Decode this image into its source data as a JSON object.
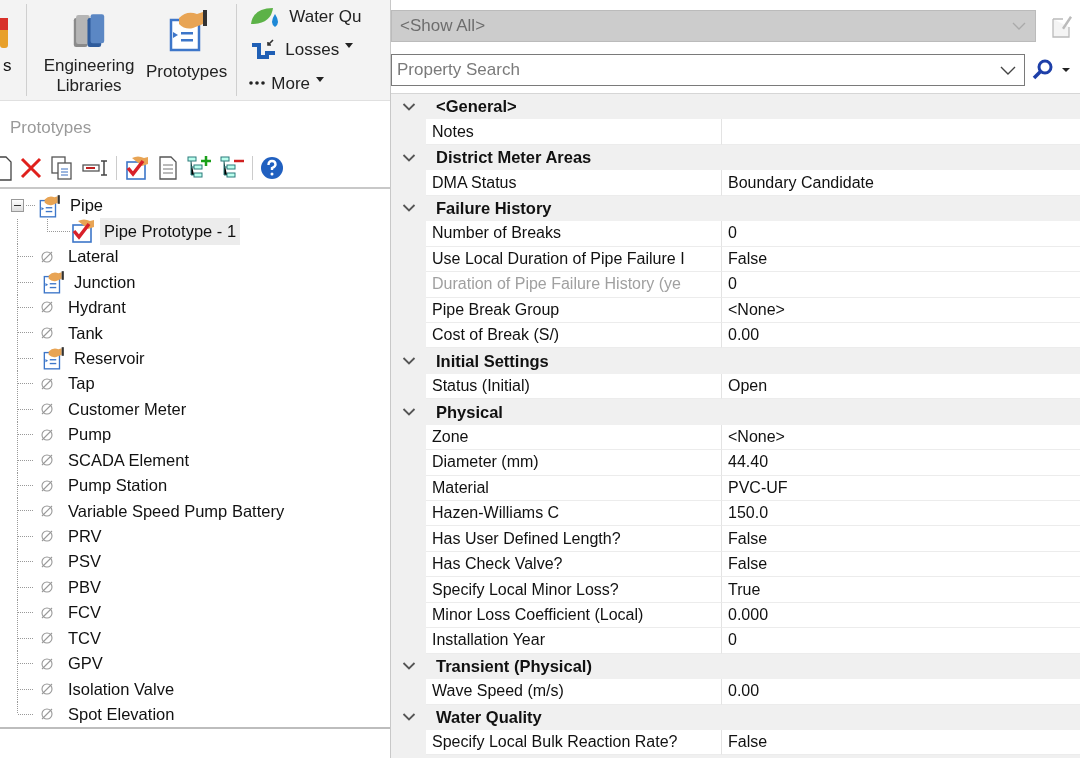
{
  "ribbon": {
    "cut_label": "s",
    "large_buttons": [
      {
        "label": "Engineering Libraries",
        "kind": "books"
      },
      {
        "label": "Prototypes",
        "kind": "prototype"
      }
    ],
    "small_buttons": [
      {
        "label": "Water Qu",
        "kind": "water",
        "dropdown": false
      },
      {
        "label": "Losses",
        "kind": "pipe",
        "dropdown": true
      },
      {
        "label": "More",
        "kind": "dots",
        "dropdown": true
      }
    ]
  },
  "panel": {
    "title": "Prototypes"
  },
  "tree": [
    {
      "label": "Pipe",
      "kind": "prototype",
      "selected": false,
      "expanded": true,
      "children": [
        {
          "label": "Pipe Prototype - 1",
          "kind": "checked",
          "selected": true
        }
      ]
    },
    {
      "label": "Lateral",
      "kind": "empty",
      "selected": false
    },
    {
      "label": "Junction",
      "kind": "prototype",
      "selected": false
    },
    {
      "label": "Hydrant",
      "kind": "empty",
      "selected": false
    },
    {
      "label": "Tank",
      "kind": "empty",
      "selected": false
    },
    {
      "label": "Reservoir",
      "kind": "prototype",
      "selected": false
    },
    {
      "label": "Tap",
      "kind": "empty",
      "selected": false
    },
    {
      "label": "Customer Meter",
      "kind": "empty",
      "selected": false
    },
    {
      "label": "Pump",
      "kind": "empty",
      "selected": false
    },
    {
      "label": "SCADA Element",
      "kind": "empty",
      "selected": false
    },
    {
      "label": "Pump Station",
      "kind": "empty",
      "selected": false
    },
    {
      "label": "Variable Speed Pump Battery",
      "kind": "empty",
      "selected": false
    },
    {
      "label": "PRV",
      "kind": "empty",
      "selected": false
    },
    {
      "label": "PSV",
      "kind": "empty",
      "selected": false
    },
    {
      "label": "PBV",
      "kind": "empty",
      "selected": false
    },
    {
      "label": "FCV",
      "kind": "empty",
      "selected": false
    },
    {
      "label": "TCV",
      "kind": "empty",
      "selected": false
    },
    {
      "label": "GPV",
      "kind": "empty",
      "selected": false
    },
    {
      "label": "Isolation Valve",
      "kind": "empty",
      "selected": false
    },
    {
      "label": "Spot Elevation",
      "kind": "empty",
      "selected": false
    }
  ],
  "properties": {
    "filter": {
      "value": "<Show All>",
      "disabled": true
    },
    "search": {
      "placeholder": "Property Search"
    },
    "categories": [
      {
        "name": "<General>",
        "expanded": true,
        "rows": [
          {
            "name": "Notes",
            "disabled": false
          }
        ]
      },
      {
        "name": "District Meter Areas",
        "expanded": true,
        "rows": [
          {
            "name": "DMA Status",
            "value": "Boundary Candidate",
            "disabled": false
          }
        ]
      },
      {
        "name": "Failure History",
        "expanded": true,
        "rows": [
          {
            "name": "Number of Breaks",
            "value": "0",
            "disabled": false
          },
          {
            "name": "Use Local Duration of Pipe Failure I",
            "value": "False",
            "disabled": false
          },
          {
            "name": "Duration of Pipe Failure History (ye",
            "value": "0",
            "disabled": true
          },
          {
            "name": "Pipe Break Group",
            "value": "<None>",
            "disabled": false
          },
          {
            "name": "Cost of Break (S/)",
            "value": "0.00",
            "disabled": false
          }
        ]
      },
      {
        "name": "Initial Settings",
        "expanded": true,
        "rows": [
          {
            "name": "Status (Initial)",
            "value": "Open",
            "disabled": false
          }
        ]
      },
      {
        "name": "Physical",
        "expanded": true,
        "rows": [
          {
            "name": "Zone",
            "value": "<None>",
            "disabled": false
          },
          {
            "name": "Diameter (mm)",
            "value": "44.40",
            "disabled": false
          },
          {
            "name": "Material",
            "value": "PVC-UF",
            "disabled": false
          },
          {
            "name": "Hazen-Williams C",
            "value": "150.0",
            "disabled": false
          },
          {
            "name": "Has User Defined Length?",
            "value": "False",
            "disabled": false
          },
          {
            "name": "Has Check Valve?",
            "value": "False",
            "disabled": false
          },
          {
            "name": "Specify Local Minor Loss?",
            "value": "True",
            "disabled": false
          },
          {
            "name": "Minor Loss Coefficient (Local)",
            "value": "0.000",
            "disabled": false
          },
          {
            "name": "Installation Year",
            "value": "0",
            "disabled": false
          }
        ]
      },
      {
        "name": "Transient (Physical)",
        "expanded": true,
        "rows": [
          {
            "name": "Wave Speed (m/s)",
            "value": "0.00",
            "disabled": false
          }
        ]
      },
      {
        "name": "Water Quality",
        "expanded": true,
        "rows": [
          {
            "name": "Specify Local Bulk Reaction Rate?",
            "value": "False",
            "disabled": false
          }
        ]
      }
    ]
  }
}
